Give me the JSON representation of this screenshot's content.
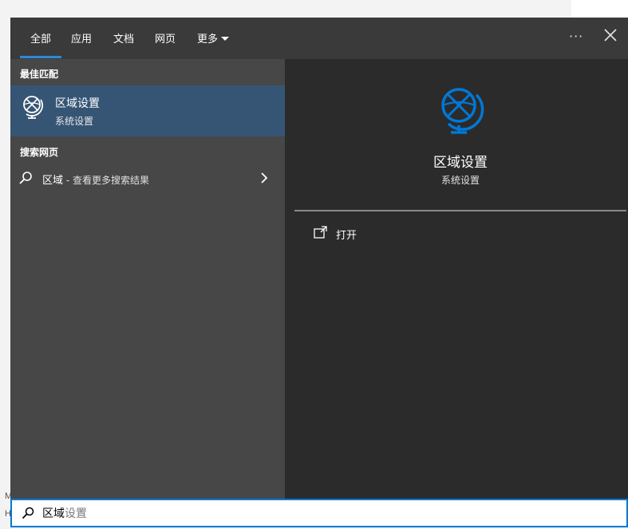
{
  "tabs": [
    {
      "label": "全部",
      "active": true
    },
    {
      "label": "应用"
    },
    {
      "label": "文档"
    },
    {
      "label": "网页"
    },
    {
      "label": "更多"
    }
  ],
  "header": {
    "more_icon": "ellipsis-icon",
    "close_icon": "close-icon"
  },
  "sections": {
    "best_match": "最佳匹配",
    "search_web": "搜索网页"
  },
  "best_match": {
    "title": "区域设置",
    "subtitle": "系统设置",
    "icon": "globe-icon"
  },
  "web_result": {
    "query": "区域",
    "suffix": " - 查看更多搜索结果",
    "icon": "search-icon"
  },
  "preview": {
    "title": "区域设置",
    "subtitle": "系统设置",
    "icon": "globe-icon",
    "accent": "#0078d7"
  },
  "actions": [
    {
      "label": "打开",
      "icon": "open-icon"
    }
  ],
  "search": {
    "typed": "区域",
    "completion": "设置",
    "icon": "search-icon"
  },
  "edge_text": [
    "M",
    "H"
  ]
}
